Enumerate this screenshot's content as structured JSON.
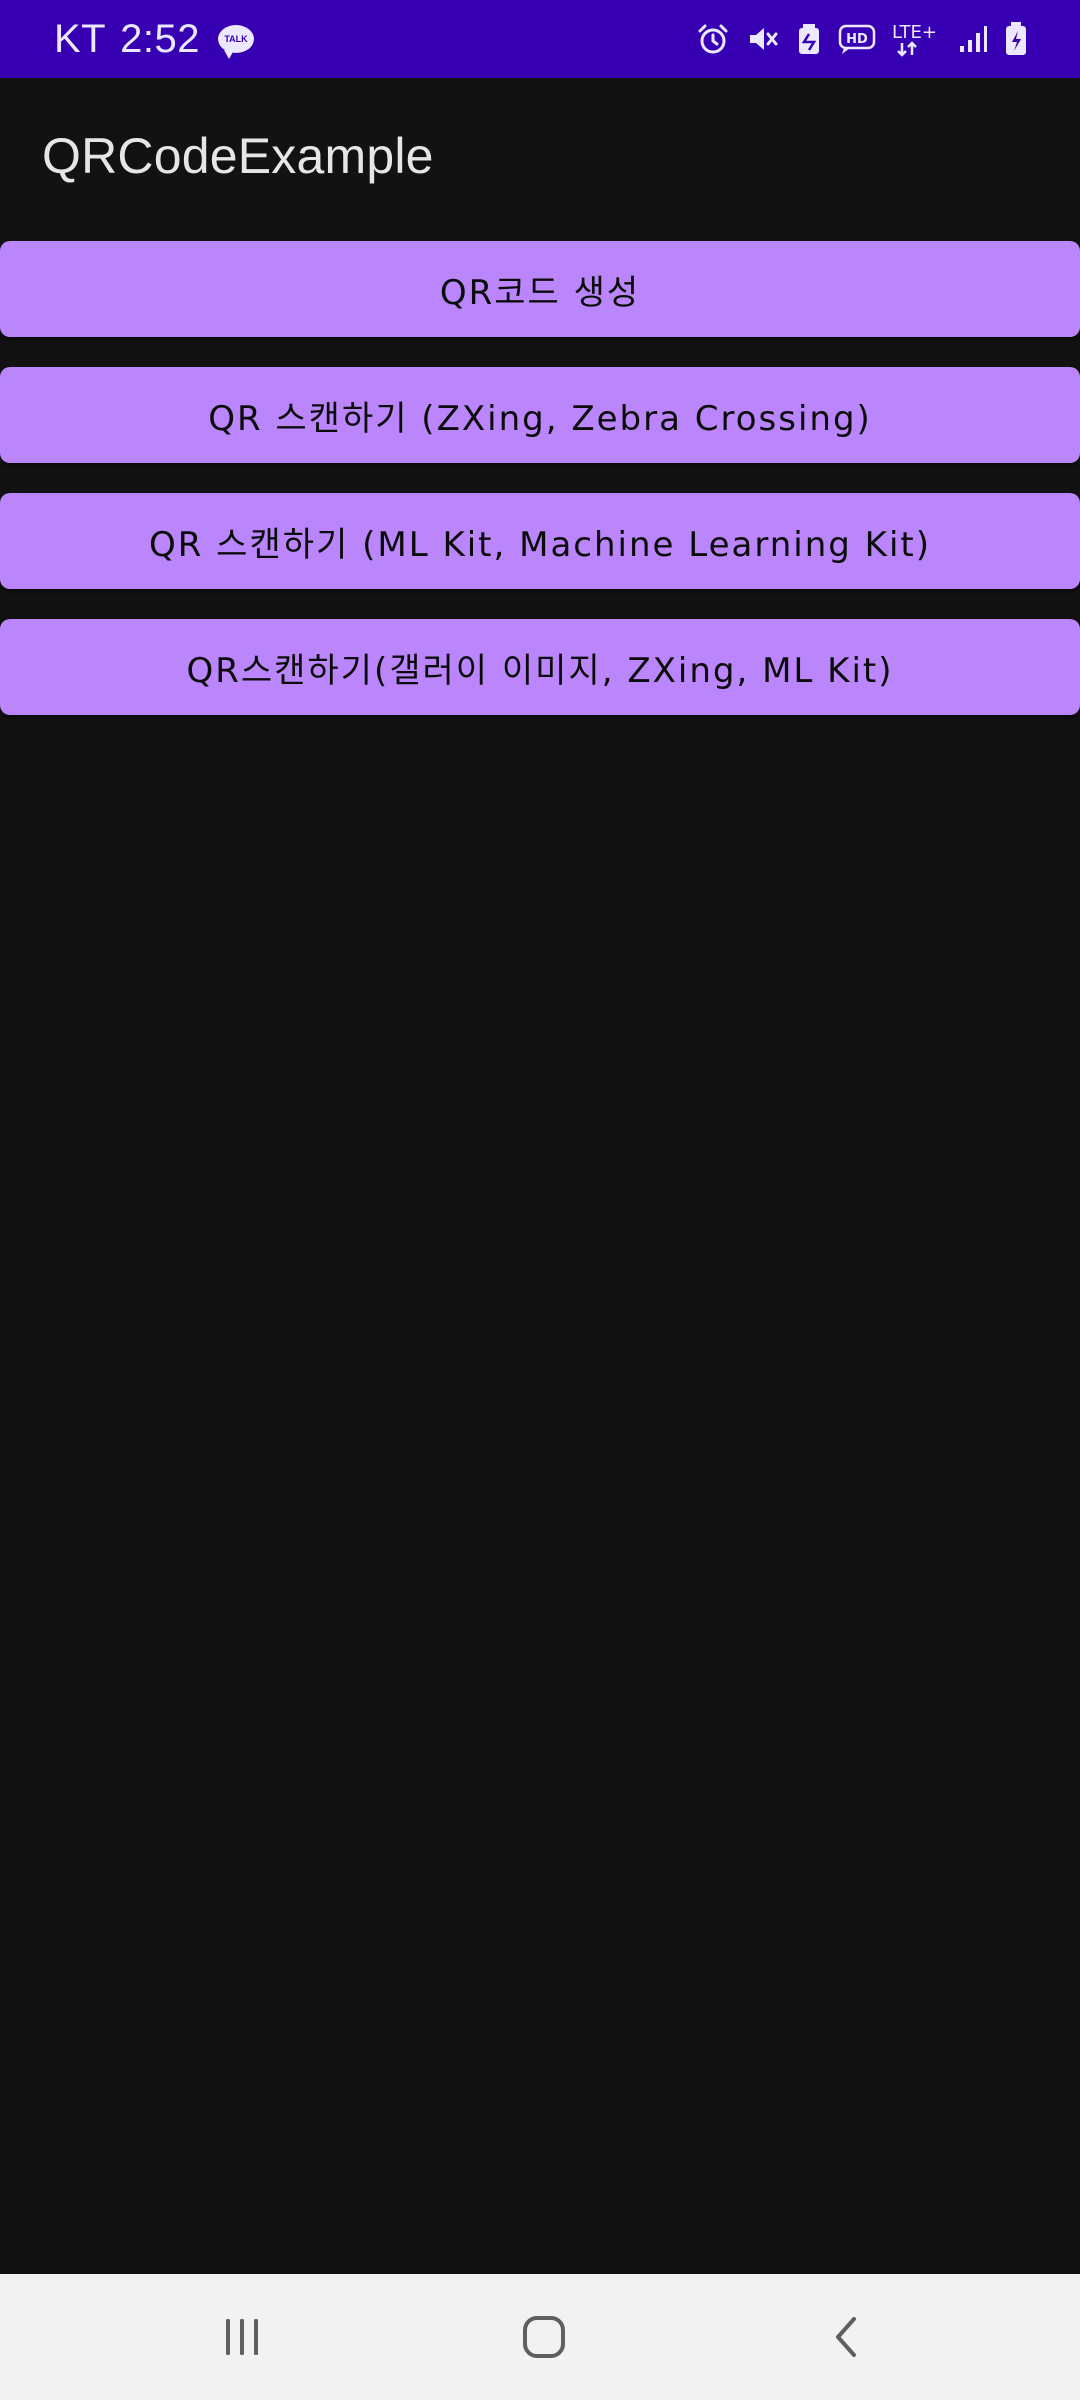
{
  "status_bar": {
    "carrier": "KT",
    "time": "2:52",
    "notification_badge": "TALK",
    "network_label": "LTE+",
    "hd_label": "HD",
    "icons": [
      "alarm-icon",
      "mute-icon",
      "battery-saver-icon",
      "hd-voice-icon",
      "lte-icon",
      "signal-icon",
      "battery-charging-icon"
    ],
    "color": "#3700b3"
  },
  "app_bar": {
    "title": "QRCodeExample"
  },
  "buttons": [
    {
      "label": "QR코드 생성"
    },
    {
      "label": "QR 스캔하기 (ZXing, Zebra Crossing)"
    },
    {
      "label": "QR 스캔하기 (ML Kit, Machine Learning Kit)"
    },
    {
      "label": "QR스캔하기(갤러이 이미지, ZXing, ML Kit)"
    }
  ],
  "nav_bar": {
    "items": [
      "recents-icon",
      "home-icon",
      "back-icon"
    ]
  },
  "colors": {
    "accent": "#bb86fc",
    "status_bar": "#3700b3",
    "background": "#121212",
    "nav_bar": "#f2f2f2"
  }
}
